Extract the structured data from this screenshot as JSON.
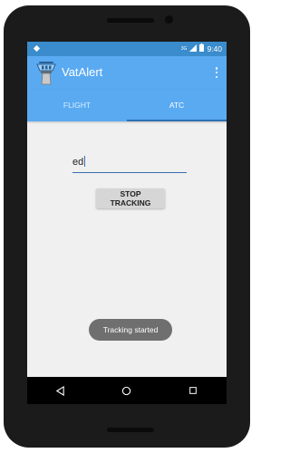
{
  "status_bar": {
    "time": "9:40",
    "network_label": "3G"
  },
  "app": {
    "title": "VatAlert"
  },
  "tabs": [
    {
      "label": "FLIGHT",
      "active": false
    },
    {
      "label": "ATC",
      "active": true
    }
  ],
  "callsign_input": {
    "value": "ed"
  },
  "stop_button": {
    "label": "STOP TRACKING"
  },
  "toast": {
    "text": "Tracking started"
  },
  "colors": {
    "status_bar": "#3a8ccc",
    "app_bar": "#5aaaf2",
    "tab_indicator": "#2f6fb0",
    "background": "#f0f0f0"
  }
}
